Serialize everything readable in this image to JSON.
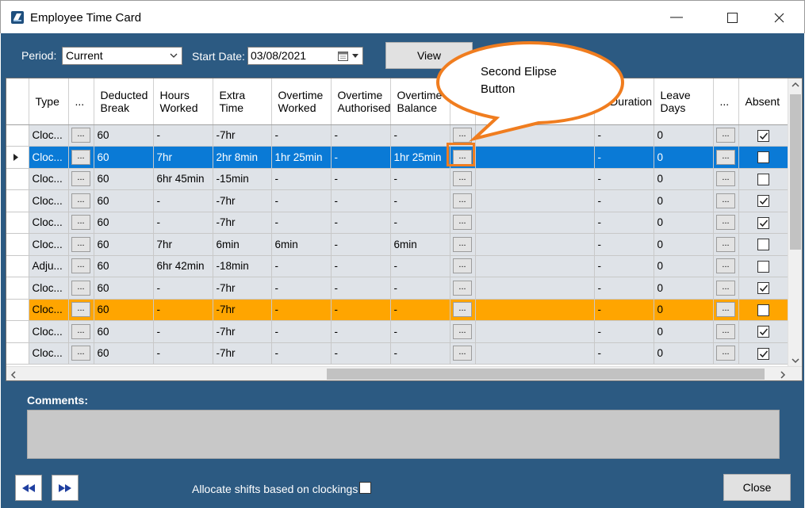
{
  "window": {
    "title": "Employee Time Card",
    "minimize_glyph": "—",
    "maximize_glyph": "☐",
    "close_glyph": "✕"
  },
  "filters": {
    "period_label": "Period:",
    "period_value": "Current",
    "start_date_label": "Start Date:",
    "start_date_value": "03/08/2021",
    "view_label": "View"
  },
  "grid": {
    "columns": [
      "Type",
      "...",
      "Deducted Break",
      "Hours Worked",
      "Extra Time",
      "Overtime Worked",
      "Overtime Authorised",
      "Overtime Balance",
      "",
      "",
      "e Duration",
      "Leave Days",
      "...",
      "Absent"
    ],
    "ellipsis_label": "...",
    "rows": [
      {
        "type": "Cloc...",
        "break": "60",
        "hours": "-",
        "extra": "-7hr",
        "ot_worked": "-",
        "ot_auth": "-",
        "ot_bal": "-",
        "duration": "-",
        "leave_days": "0",
        "absent": true,
        "state": "normal"
      },
      {
        "type": "Cloc...",
        "break": "60",
        "hours": "7hr",
        "extra": "2hr 8min",
        "ot_worked": "1hr 25min",
        "ot_auth": "-",
        "ot_bal": "1hr 25min",
        "duration": "-",
        "leave_days": "0",
        "absent": false,
        "state": "selected"
      },
      {
        "type": "Cloc...",
        "break": "60",
        "hours": "6hr 45min",
        "extra": "-15min",
        "ot_worked": "-",
        "ot_auth": "-",
        "ot_bal": "-",
        "duration": "-",
        "leave_days": "0",
        "absent": false,
        "state": "normal"
      },
      {
        "type": "Cloc...",
        "break": "60",
        "hours": "-",
        "extra": "-7hr",
        "ot_worked": "-",
        "ot_auth": "-",
        "ot_bal": "-",
        "duration": "-",
        "leave_days": "0",
        "absent": true,
        "state": "normal"
      },
      {
        "type": "Cloc...",
        "break": "60",
        "hours": "-",
        "extra": "-7hr",
        "ot_worked": "-",
        "ot_auth": "-",
        "ot_bal": "-",
        "duration": "-",
        "leave_days": "0",
        "absent": true,
        "state": "normal"
      },
      {
        "type": "Cloc...",
        "break": "60",
        "hours": "7hr",
        "extra": "6min",
        "ot_worked": "6min",
        "ot_auth": "-",
        "ot_bal": "6min",
        "duration": "-",
        "leave_days": "0",
        "absent": false,
        "state": "normal"
      },
      {
        "type": "Adju...",
        "break": "60",
        "hours": "6hr 42min",
        "extra": "-18min",
        "ot_worked": "-",
        "ot_auth": "-",
        "ot_bal": "-",
        "duration": "-",
        "leave_days": "0",
        "absent": false,
        "state": "normal"
      },
      {
        "type": "Cloc...",
        "break": "60",
        "hours": "-",
        "extra": "-7hr",
        "ot_worked": "-",
        "ot_auth": "-",
        "ot_bal": "-",
        "duration": "-",
        "leave_days": "0",
        "absent": true,
        "state": "normal"
      },
      {
        "type": "Cloc...",
        "break": "60",
        "hours": "-",
        "extra": "-7hr",
        "ot_worked": "-",
        "ot_auth": "-",
        "ot_bal": "-",
        "duration": "-",
        "leave_days": "0",
        "absent": false,
        "state": "highlight"
      },
      {
        "type": "Cloc...",
        "break": "60",
        "hours": "-",
        "extra": "-7hr",
        "ot_worked": "-",
        "ot_auth": "-",
        "ot_bal": "-",
        "duration": "-",
        "leave_days": "0",
        "absent": true,
        "state": "normal"
      },
      {
        "type": "Cloc...",
        "break": "60",
        "hours": "-",
        "extra": "-7hr",
        "ot_worked": "-",
        "ot_auth": "-",
        "ot_bal": "-",
        "duration": "-",
        "leave_days": "0",
        "absent": true,
        "state": "normal"
      }
    ]
  },
  "callout": {
    "line1": "Second Elipse",
    "line2": "Button",
    "color": "#f07d1f"
  },
  "comments": {
    "label": "Comments:",
    "value": ""
  },
  "footer": {
    "allocate_label": "Allocate shifts based on clockings",
    "allocate_checked": false,
    "close_label": "Close"
  },
  "colors": {
    "window_bg": "#2c5a82",
    "selected_row": "#0a7ad6",
    "highlight_row": "#ffa500",
    "nav_arrow": "#1f3fa0"
  },
  "icons": {
    "app": "app-logo-icon",
    "first": "rewind-icon",
    "next": "fast-forward-icon",
    "row_indicator": "row-pointer-icon"
  }
}
